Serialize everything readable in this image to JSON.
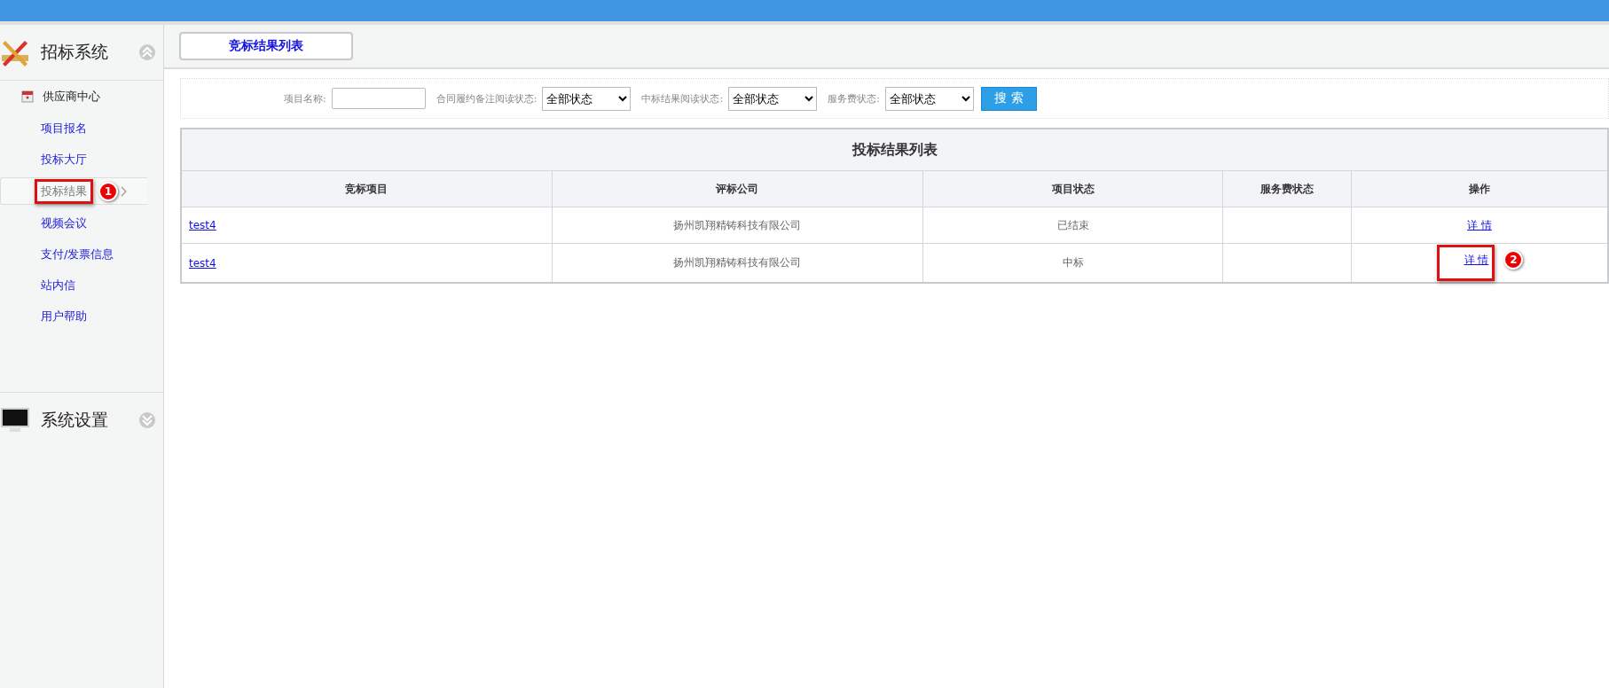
{
  "sidebar": {
    "sections": [
      {
        "title": "招标系统",
        "expanded": true,
        "group": "供应商中心",
        "items": [
          {
            "label": "项目报名",
            "selected": false
          },
          {
            "label": "投标大厅",
            "selected": false
          },
          {
            "label": "投标结果",
            "selected": true,
            "callout": "1"
          },
          {
            "label": "视频会议",
            "selected": false
          },
          {
            "label": "支付/发票信息",
            "selected": false
          },
          {
            "label": "站内信",
            "selected": false
          },
          {
            "label": "用户帮助",
            "selected": false
          }
        ]
      },
      {
        "title": "系统设置",
        "expanded": false
      }
    ]
  },
  "tabs": [
    {
      "label": "竞标结果列表",
      "selected": true
    }
  ],
  "filters": [
    {
      "kind": "input",
      "label": "项目名称:"
    },
    {
      "kind": "select",
      "label": "合同履约备注阅读状态:",
      "value": "全部状态"
    },
    {
      "kind": "select",
      "label": "中标结果阅读状态:",
      "value": "全部状态"
    },
    {
      "kind": "select",
      "label": "服务费状态:",
      "value": "全部状态"
    }
  ],
  "search_button": "搜 索",
  "table": {
    "title": "投标结果列表",
    "columns": [
      "竞标项目",
      "评标公司",
      "项目状态",
      "服务费状态",
      "操作"
    ],
    "rows": [
      {
        "project": "test4",
        "company": "扬州凯翔精铸科技有限公司",
        "status": "已结束",
        "fee_status": "",
        "action": "详 情"
      },
      {
        "project": "test4",
        "company": "扬州凯翔精铸科技有限公司",
        "status": "中标",
        "fee_status": "",
        "action": "详 情",
        "callout": "2"
      }
    ]
  }
}
